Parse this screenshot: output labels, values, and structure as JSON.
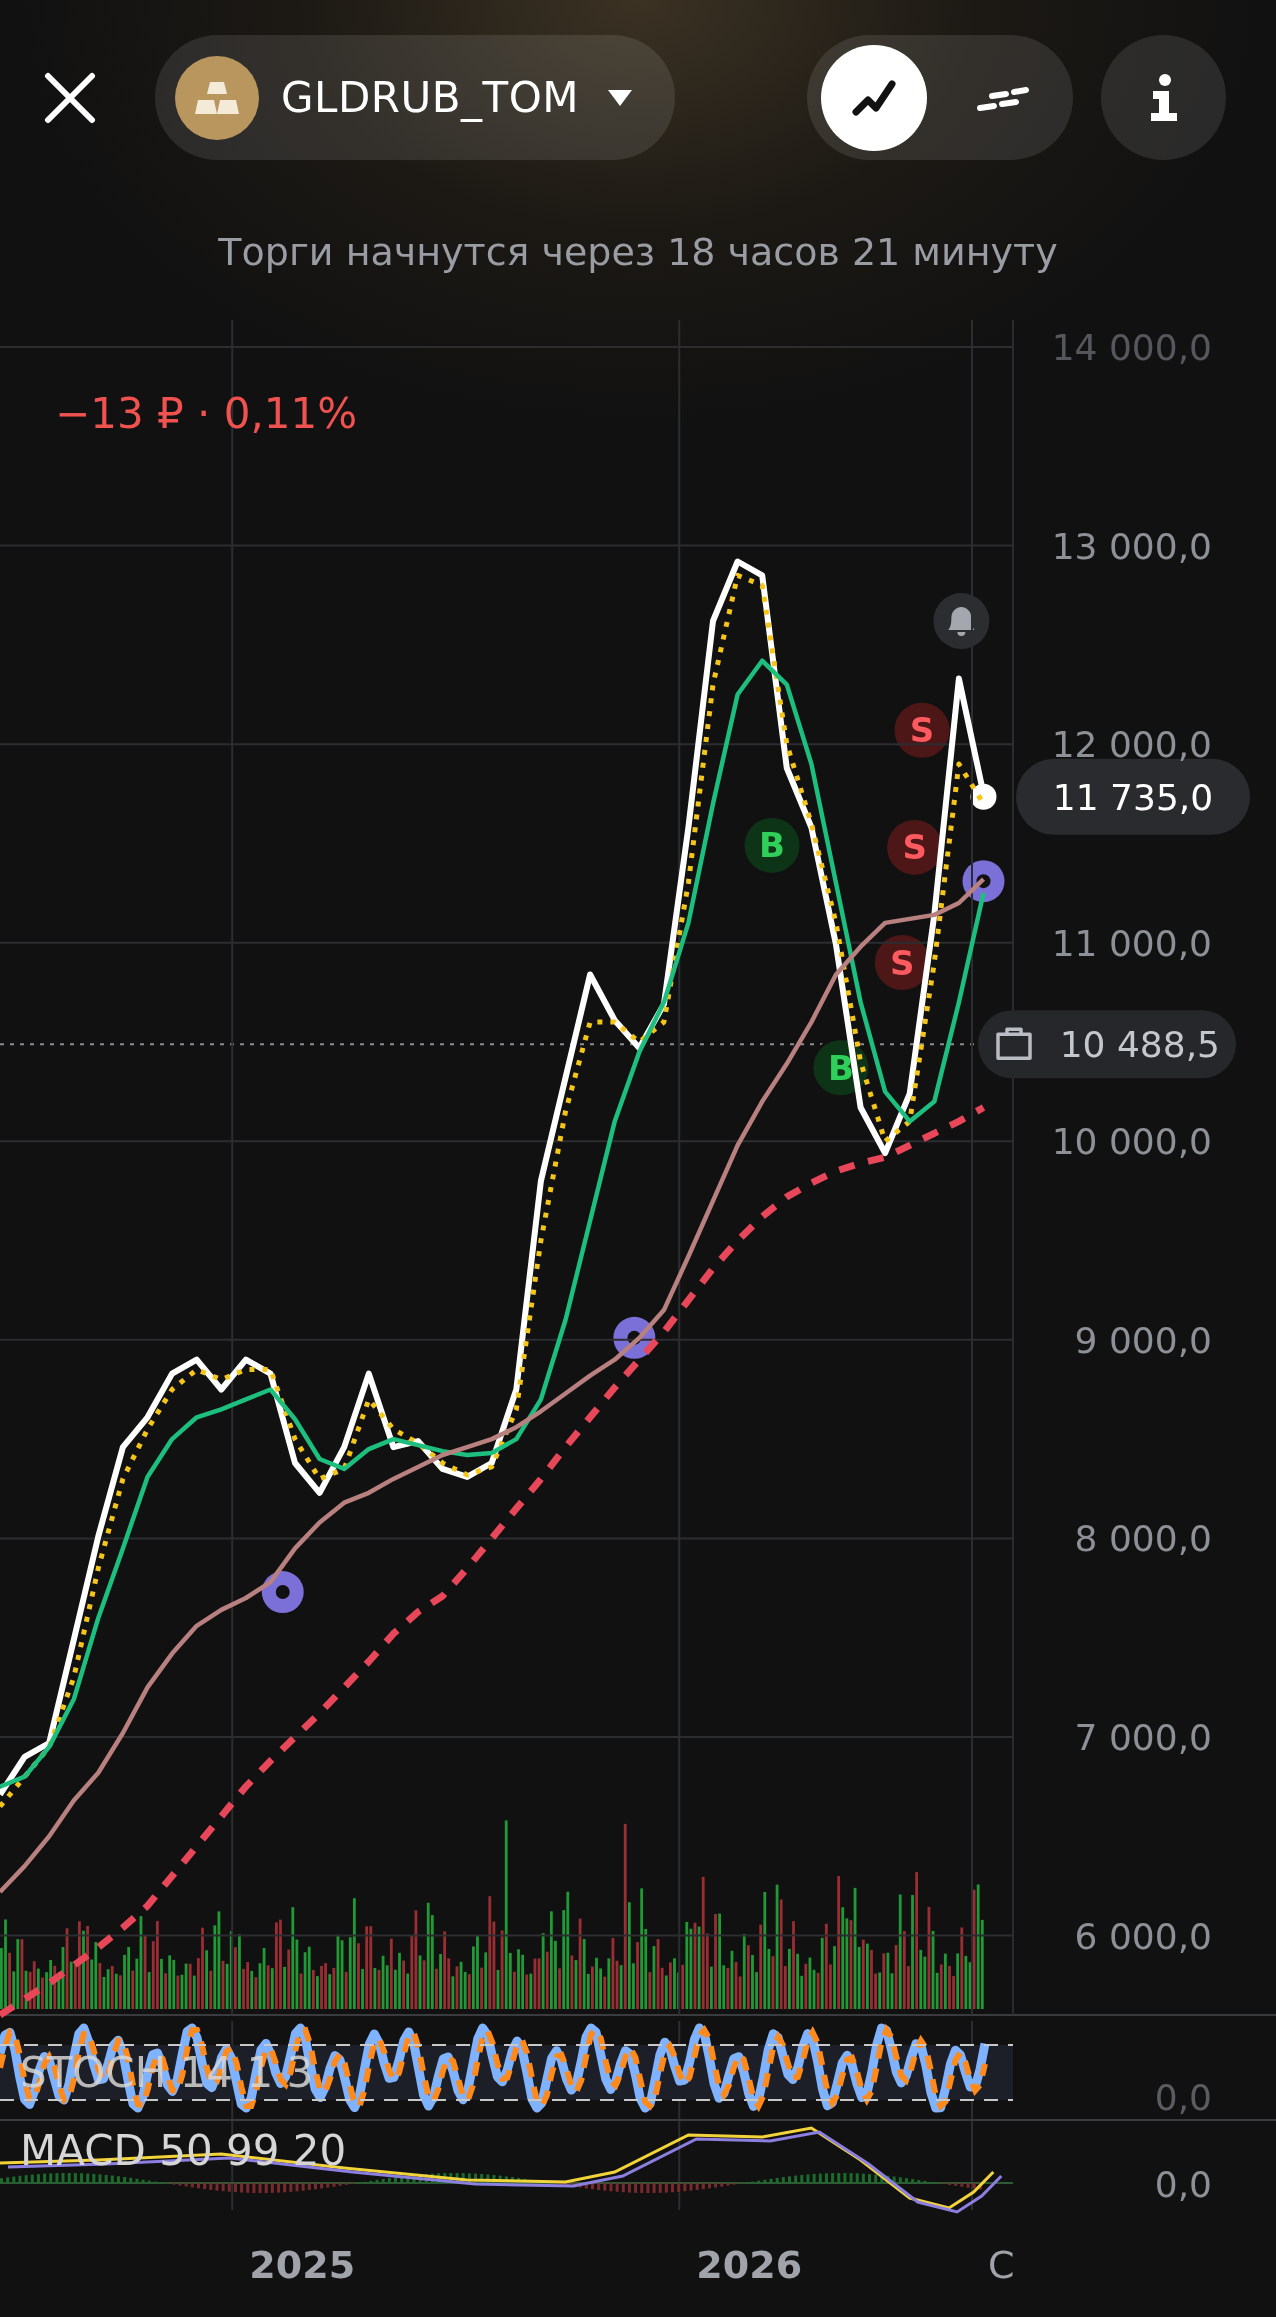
{
  "header": {
    "ticker": {
      "name": "GLDRUB_TOM"
    },
    "view_toggle": [
      {
        "kind": "line",
        "selected": true
      },
      {
        "kind": "bars",
        "selected": false
      }
    ],
    "status": "Торги начнутся через 18 часов 21 минуту"
  },
  "chart": {
    "change": "−13 ₽ · 0,11%",
    "stoch_label": "STOCH 14 1 3",
    "stoch_axis_label": "0,0",
    "macd_label": "MACD 50 99 20",
    "macd_axis_label": "0,0",
    "partial_axis_label": "C",
    "last_price": "11 735,0",
    "position_price": "10 488,5",
    "signals": [
      {
        "label": "B",
        "color": "#2fd05a"
      },
      {
        "label": "B",
        "color": "#2fd05a"
      },
      {
        "label": "S",
        "color": "#ff5a5f"
      },
      {
        "label": "S",
        "color": "#ff5a5f"
      },
      {
        "label": "S",
        "color": "#ff5a5f"
      }
    ],
    "chart_data": {
      "type": "line",
      "grid": true,
      "xlim": [
        2024.324,
        2026.59
      ],
      "ylim": [
        5600,
        14136
      ],
      "x": [
        2024.324,
        2024.379,
        2024.434,
        2024.489,
        2024.544,
        2024.599,
        2024.654,
        2024.709,
        2024.764,
        2024.819,
        2024.874,
        2024.929,
        2024.984,
        2025.039,
        2025.094,
        2025.149,
        2025.204,
        2025.259,
        2025.314,
        2025.369,
        2025.424,
        2025.479,
        2025.534,
        2025.589,
        2025.644,
        2025.699,
        2025.754,
        2025.809,
        2025.864,
        2025.919,
        2025.974,
        2026.029,
        2026.084,
        2026.139,
        2026.194,
        2026.249,
        2026.304,
        2026.359,
        2026.414,
        2026.469,
        2026.524
      ],
      "series": [
        {
          "color": "#ffffff",
          "values": [
            6710,
            6900,
            6970,
            7490,
            8010,
            8460,
            8610,
            8830,
            8900,
            8750,
            8900,
            8830,
            8380,
            8230,
            8460,
            8830,
            8460,
            8490,
            8350,
            8310,
            8380,
            8750,
            9800,
            10320,
            10840,
            10610,
            10470,
            10690,
            11580,
            12620,
            12920,
            12850,
            11880,
            11580,
            10990,
            10170,
            9940,
            10240,
            11140,
            12330,
            11750
          ]
        },
        {
          "color": "#f5c518",
          "line_style": "dotted",
          "values": [
            6650,
            6800,
            6950,
            7300,
            7850,
            8300,
            8550,
            8750,
            8850,
            8800,
            8850,
            8850,
            8500,
            8300,
            8350,
            8700,
            8550,
            8480,
            8380,
            8320,
            8360,
            8650,
            9500,
            10150,
            10600,
            10600,
            10500,
            10600,
            11300,
            12300,
            12850,
            12800,
            12000,
            11600,
            11100,
            10400,
            10000,
            10100,
            10900,
            11900,
            11700
          ]
        },
        {
          "color": "#1dbf7f",
          "values": [
            6750,
            6800,
            6950,
            7190,
            7600,
            7950,
            8310,
            8500,
            8610,
            8650,
            8700,
            8750,
            8600,
            8400,
            8350,
            8450,
            8500,
            8470,
            8440,
            8420,
            8430,
            8500,
            8700,
            9100,
            9600,
            10100,
            10450,
            10700,
            11100,
            11700,
            12250,
            12420,
            12300,
            11900,
            11300,
            10700,
            10250,
            10100,
            10200,
            10700,
            11250
          ]
        },
        {
          "color": "#b8807f",
          "values": [
            6220,
            6350,
            6500,
            6680,
            6820,
            7020,
            7250,
            7420,
            7560,
            7640,
            7700,
            7780,
            7950,
            8080,
            8180,
            8230,
            8300,
            8360,
            8420,
            8460,
            8500,
            8560,
            8640,
            8730,
            8820,
            8900,
            9010,
            9150,
            9420,
            9700,
            9980,
            10200,
            10390,
            10600,
            10840,
            10980,
            11100,
            11120,
            11140,
            11200,
            11320
          ]
        },
        {
          "color": "#e8475a",
          "line_style": "dashed",
          "values": [
            5600,
            5680,
            5760,
            5850,
            5940,
            6040,
            6150,
            6300,
            6450,
            6600,
            6750,
            6880,
            7000,
            7120,
            7250,
            7380,
            7520,
            7630,
            7710,
            7850,
            8000,
            8150,
            8300,
            8460,
            8610,
            8760,
            8900,
            9040,
            9200,
            9360,
            9500,
            9620,
            9720,
            9790,
            9850,
            9890,
            9920,
            9980,
            10040,
            10100,
            10170
          ]
        }
      ],
      "yticks": [
        {
          "value": 14000,
          "label": "14 000,0"
        },
        {
          "value": 13000,
          "label": "13 000,0"
        },
        {
          "value": 12000,
          "label": "12 000,0"
        },
        {
          "value": 11000,
          "label": "11 000,0"
        },
        {
          "value": 10000,
          "label": "10 000,0"
        },
        {
          "value": 9000,
          "label": "9 000,0"
        },
        {
          "value": 8000,
          "label": "8 000,0"
        },
        {
          "value": 7000,
          "label": "7 000,0"
        },
        {
          "value": 6000,
          "label": "6 000,0"
        }
      ],
      "xticks": [
        {
          "value": 2025,
          "label": "2025"
        },
        {
          "value": 2026,
          "label": "2026"
        }
      ]
    }
  }
}
